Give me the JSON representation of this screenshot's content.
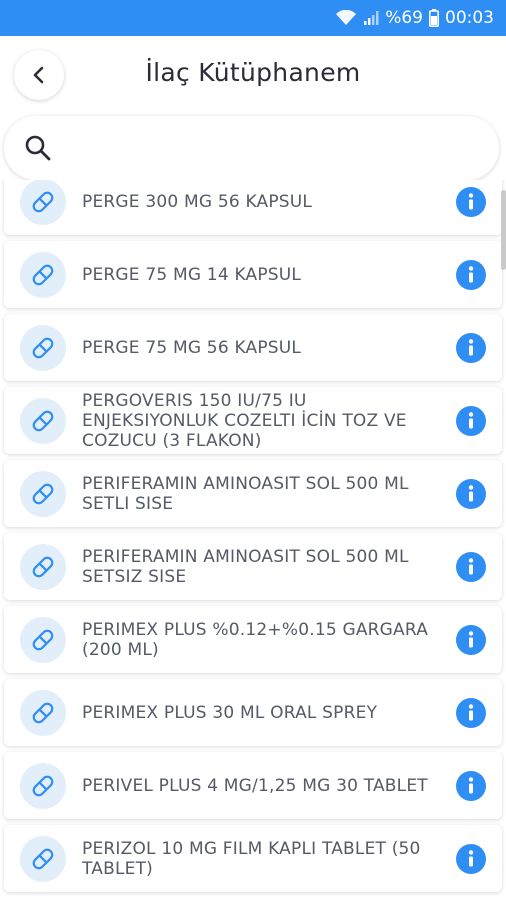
{
  "status_bar": {
    "battery": "%69",
    "time": "00:03",
    "icons": [
      "wifi-icon",
      "signal-icon",
      "battery-icon"
    ]
  },
  "header": {
    "title": "İlaç Kütüphanem",
    "back_icon": "chevron-left-icon"
  },
  "search": {
    "placeholder": "",
    "value": "",
    "icon": "search-icon"
  },
  "colors": {
    "accent": "#2f8ef4",
    "badge_bg": "#e3eefb",
    "text": "#555a66",
    "title": "#2b2b3a"
  },
  "items": [
    {
      "label": "PERGE 300 MG 56 KAPSUL",
      "icon": "pill-icon",
      "action_icon": "info-icon"
    },
    {
      "label": "PERGE 75 MG 14 KAPSUL",
      "icon": "pill-icon",
      "action_icon": "info-icon"
    },
    {
      "label": "PERGE 75 MG 56 KAPSUL",
      "icon": "pill-icon",
      "action_icon": "info-icon"
    },
    {
      "label": "PERGOVERIS 150 IU/75 IU ENJEKSIYONLUK COZELTI İCİN TOZ VE COZUCU (3 FLAKON)",
      "icon": "pill-icon",
      "action_icon": "info-icon"
    },
    {
      "label": "PERIFERAMIN AMINOASIT SOL 500 ML SETLI SISE",
      "icon": "pill-icon",
      "action_icon": "info-icon"
    },
    {
      "label": "PERIFERAMIN AMINOASIT SOL 500 ML SETSIZ SISE",
      "icon": "pill-icon",
      "action_icon": "info-icon"
    },
    {
      "label": "PERIMEX PLUS %0.12+%0.15 GARGARA (200 ML)",
      "icon": "pill-icon",
      "action_icon": "info-icon"
    },
    {
      "label": "PERIMEX PLUS 30 ML ORAL SPREY",
      "icon": "pill-icon",
      "action_icon": "info-icon"
    },
    {
      "label": "PERIVEL PLUS 4 MG/1,25 MG 30 TABLET",
      "icon": "pill-icon",
      "action_icon": "info-icon"
    },
    {
      "label": "PERIZOL 10 MG FILM KAPLI TABLET (50 TABLET)",
      "icon": "pill-icon",
      "action_icon": "info-icon"
    }
  ]
}
